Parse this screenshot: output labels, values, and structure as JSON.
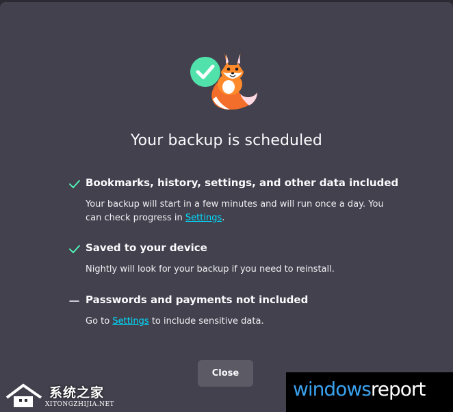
{
  "dialog": {
    "title": "Your backup is scheduled",
    "items": [
      {
        "status": "included",
        "heading": "Bookmarks, history, settings, and other data included",
        "desc_before": "Your backup will start in a few minutes and will run once a day. You can check progress in",
        "link": "Settings",
        "desc_after": "."
      },
      {
        "status": "included",
        "heading": "Saved to your device",
        "desc_before": "Nightly will look for your backup if you need to reinstall.",
        "link": "",
        "desc_after": ""
      },
      {
        "status": "not-included",
        "heading": "Passwords and payments not included",
        "desc_before": "Go to",
        "link": "Settings",
        "desc_after": "to include sensitive data."
      }
    ],
    "close_label": "Close"
  },
  "colors": {
    "background": "#2b2a33",
    "dialog": "#42414d",
    "check": "#54ffbd",
    "link": "#00ddff",
    "button": "#5b5a65"
  },
  "watermarks": {
    "left_zh": "系统之家",
    "left_en": "XITONGZHIJIA.NET",
    "right_part1": "windows",
    "right_part2": "report"
  }
}
